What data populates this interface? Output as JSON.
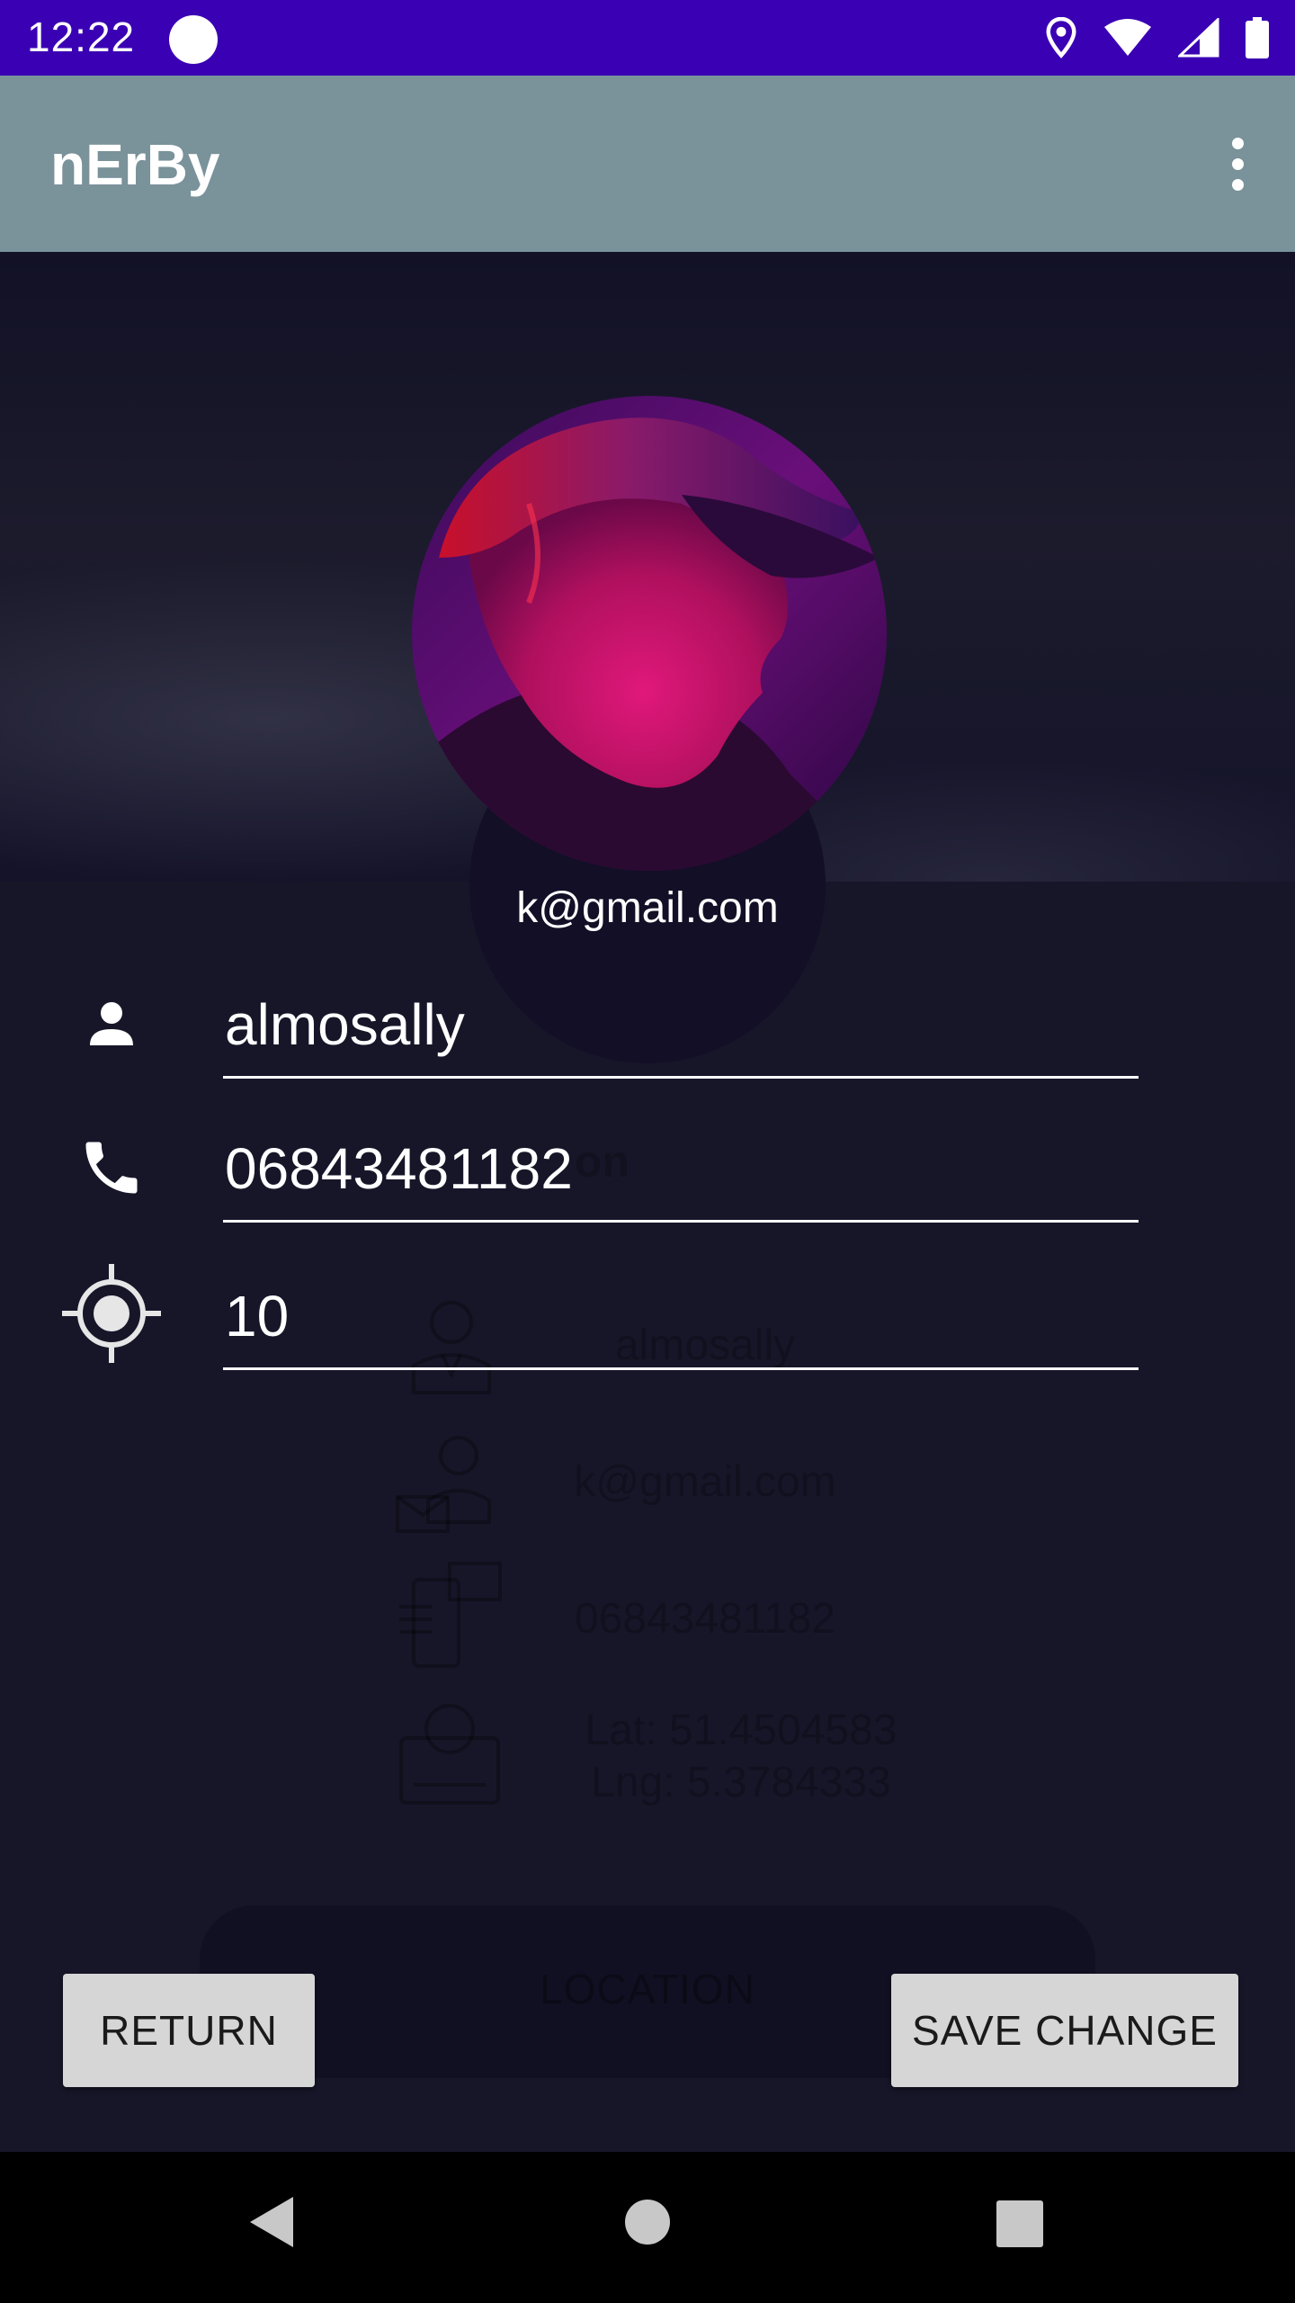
{
  "status_bar": {
    "time": "12:22"
  },
  "app_bar": {
    "title": "nErBy"
  },
  "profile": {
    "email": "k@gmail.com"
  },
  "form": {
    "name_value": "almosally",
    "phone_value": "06843481182",
    "radius_value": "10"
  },
  "background_card": {
    "heading": "on",
    "name": "almosally",
    "email": "k@gmail.com",
    "phone": "06843481182",
    "lat": "Lat: 51.4504583",
    "lng": "Lng: 5.3784333",
    "location_button_label": "LOCATION"
  },
  "buttons": {
    "return_label": "RETURN",
    "save_label": "SAVE CHANGE"
  },
  "colors": {
    "status_bar": "#3a00b4",
    "app_bar": "#7a929a",
    "background": "#171629",
    "button": "#d6d6d6"
  },
  "icons": {
    "status": [
      "location-icon",
      "wifi-icon",
      "signal-icon",
      "battery-icon"
    ],
    "fields": [
      "person-icon",
      "phone-icon",
      "gps-target-icon"
    ],
    "avatar_edit": "pencil-icon",
    "nav": [
      "back-icon",
      "home-icon",
      "recents-icon"
    ]
  }
}
